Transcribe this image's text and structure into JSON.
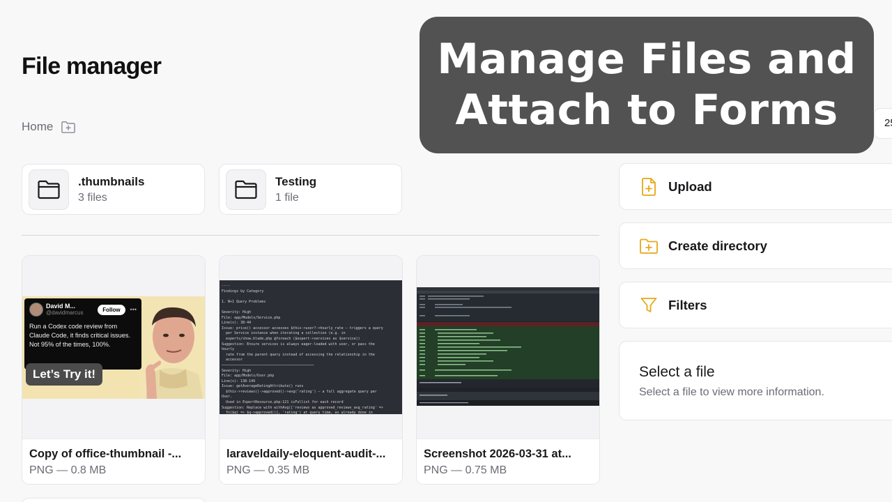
{
  "page": {
    "title": "File manager"
  },
  "breadcrumb": {
    "home": "Home",
    "new_folder_icon": "folder-plus-icon"
  },
  "folders": [
    {
      "name": ".thumbnails",
      "count": "3 files",
      "icon": "folder-icon"
    },
    {
      "name": "Testing",
      "count": "1 file",
      "icon": "folder-icon"
    }
  ],
  "files": [
    {
      "name": "Copy of office-thumbnail -...",
      "meta": "PNG — 0.8 MB",
      "thumb": {
        "tweet_name": "David M...",
        "tweet_handle": "@davidmarcus",
        "tweet_follow": "Follow",
        "tweet_text": "Run a Codex code review from Claude Code, it finds critical issues. Not 95% of the times, 100%.",
        "pill": "Let’s Try it!"
      }
    },
    {
      "name": "laraveldaily-eloquent-audit-...",
      "meta": "PNG — 0.35 MB",
      "thumb": {
        "code": "----\nFindings by Category\n\n1. N+1 Query Problems\n\nSeverity: High\nFile: app/Models/Service.php\nLine(s): 38-44\nIssue: price() accessor accesses $this->user?->hourly_rate — triggers a query\n  per Service instance when iterating a collection (e.g. in\n  experts/show.blade.php @foreach ($expert->services as $service))\nSuggestion: Ensure services is always eager-loaded with user, or pass the\nhourly\n  rate from the parent query instead of accessing the relationship in the\n  accessor\n────────────────────────────────────────────\nSeverity: High\nFile: app/Models/User.php\nLine(s): 138-149\nIssue: getAverageRatingAttribute() runs\n  $this->reviews()->approved()->avg('rating') — a full aggregate query per\nUser.\n  Used in ExpertResource.php:121 isFullist for each record\nSuggestion: Replace with withAvg(['reviews as approved_reviews_avg_rating' =>\n  fn($q) => $q->approved()], 'rating') at query time, as already done in\n  HomeController and DirectorySearch"
      }
    },
    {
      "name": "Screenshot 2026-03-31 at...",
      "meta": "PNG — 0.75 MB"
    }
  ],
  "actions": [
    {
      "label": "Upload",
      "icon": "file-plus-icon"
    },
    {
      "label": "Create directory",
      "icon": "folder-plus-icon"
    },
    {
      "label": "Filters",
      "icon": "funnel-icon"
    }
  ],
  "partial_control": {
    "text": "25"
  },
  "info": {
    "title": "Select a file",
    "subtitle": "Select a file to view more information."
  },
  "overlay": {
    "line1": "Manage Files and",
    "line2": "Attach to Forms"
  },
  "colors": {
    "accent_yellow": "#e6a817",
    "overlay_bg": "#525252"
  }
}
